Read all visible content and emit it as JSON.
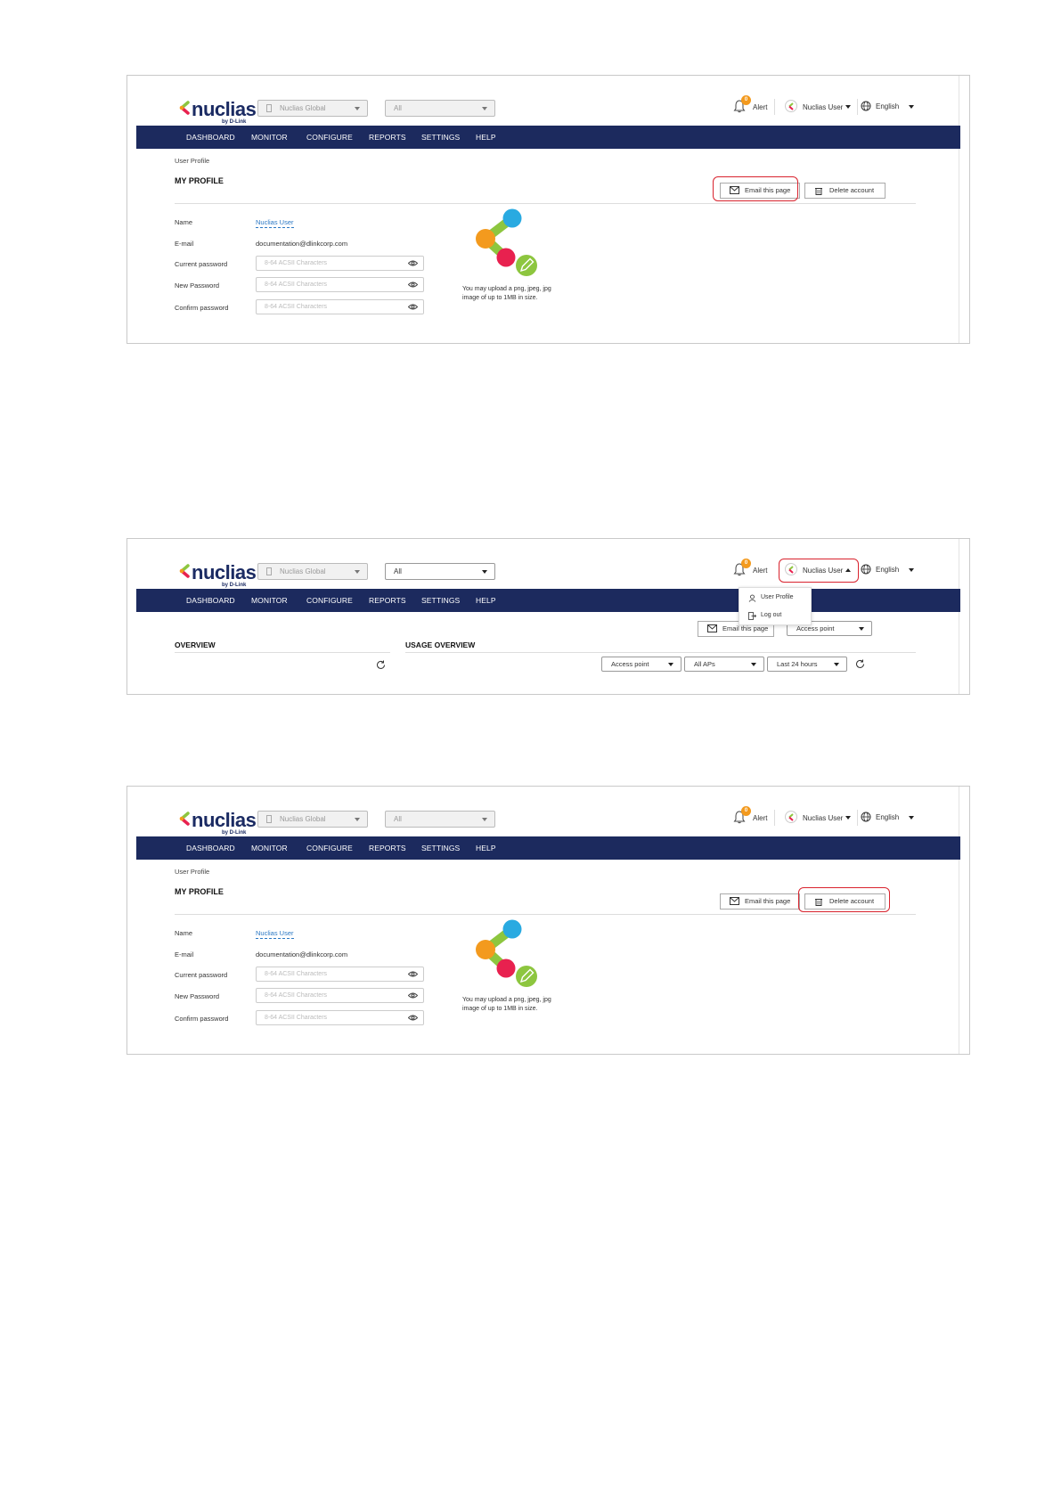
{
  "app": {
    "brand": "nuclias",
    "brand_sub": "by D-Link",
    "site_select": "Nuclias Global",
    "network_select": "All",
    "alert_count": "0",
    "alert_label": "Alert",
    "user_label": "Nuclias User",
    "language_label": "English"
  },
  "nav": {
    "items": [
      "DASHBOARD",
      "MONITOR",
      "CONFIGURE",
      "REPORTS",
      "SETTINGS",
      "HELP"
    ]
  },
  "profile": {
    "breadcrumb": "User Profile",
    "title": "MY PROFILE",
    "email_button": "Email this page",
    "delete_button": "Delete account",
    "labels": {
      "name": "Name",
      "email": "E-mail",
      "current_password": "Current password",
      "new_password": "New Password",
      "confirm_password": "Confirm password"
    },
    "name_value": "Nuclias User",
    "email_value": "documentation@dlinkcorp.com",
    "password_placeholder": "8-64 ACSII Characters",
    "upload_hint_line1": "You may upload a png, jpeg, jpg",
    "upload_hint_line2": "image of up to 1MB in size."
  },
  "dashboard": {
    "user_menu": {
      "user_profile": "User Profile",
      "log_out": "Log out"
    },
    "email_button_partial": "Email this page",
    "device_filter": "Access point",
    "overview_title": "OVERVIEW",
    "usage_title": "USAGE OVERVIEW",
    "filters": {
      "device_type": "Access point",
      "aps": "All APs",
      "time_range": "Last 24 hours"
    }
  },
  "colors": {
    "brand_navy": "#1c2a5e",
    "highlight_red": "#d9232e",
    "link_blue": "#2b78c4",
    "badge_orange": "#f39a1e"
  }
}
